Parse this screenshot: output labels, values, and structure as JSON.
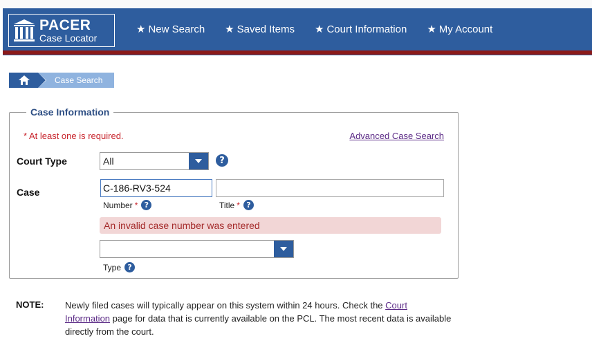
{
  "header": {
    "logo_title": "PACER",
    "logo_subtitle": "Case Locator",
    "nav": [
      {
        "label": "New Search"
      },
      {
        "label": "Saved Items"
      },
      {
        "label": "Court Information"
      },
      {
        "label": "My Account"
      }
    ],
    "nav_star": "★"
  },
  "breadcrumb": {
    "home_icon": "home-icon",
    "current": "Case Search"
  },
  "form": {
    "legend": "Case Information",
    "required_note": "* At least one is required.",
    "advanced_link": "Advanced Case Search",
    "court_type_label": "Court Type",
    "court_type_value": "All",
    "case_label": "Case",
    "case_number_value": "C-186-RV3-524",
    "case_title_value": "",
    "number_label": "Number",
    "title_label": "Title",
    "required_mark": "*",
    "error_message": "An invalid case number was entered",
    "type_value": "",
    "type_label": "Type",
    "help_glyph": "?"
  },
  "note": {
    "label": "NOTE:",
    "text_before": "Newly filed cases will typically appear on this system within 24 hours. Check the ",
    "link": "Court Information",
    "text_after": " page for data that is currently available on the PCL. The most recent data is available directly from the court."
  },
  "colors": {
    "header_blue": "#2e5d9e",
    "header_red": "#8b1a1a",
    "breadcrumb_light": "#8fb3df",
    "required_red": "#c8242c",
    "error_bg": "#f2d6d6",
    "link_purple": "#5b2a86"
  }
}
